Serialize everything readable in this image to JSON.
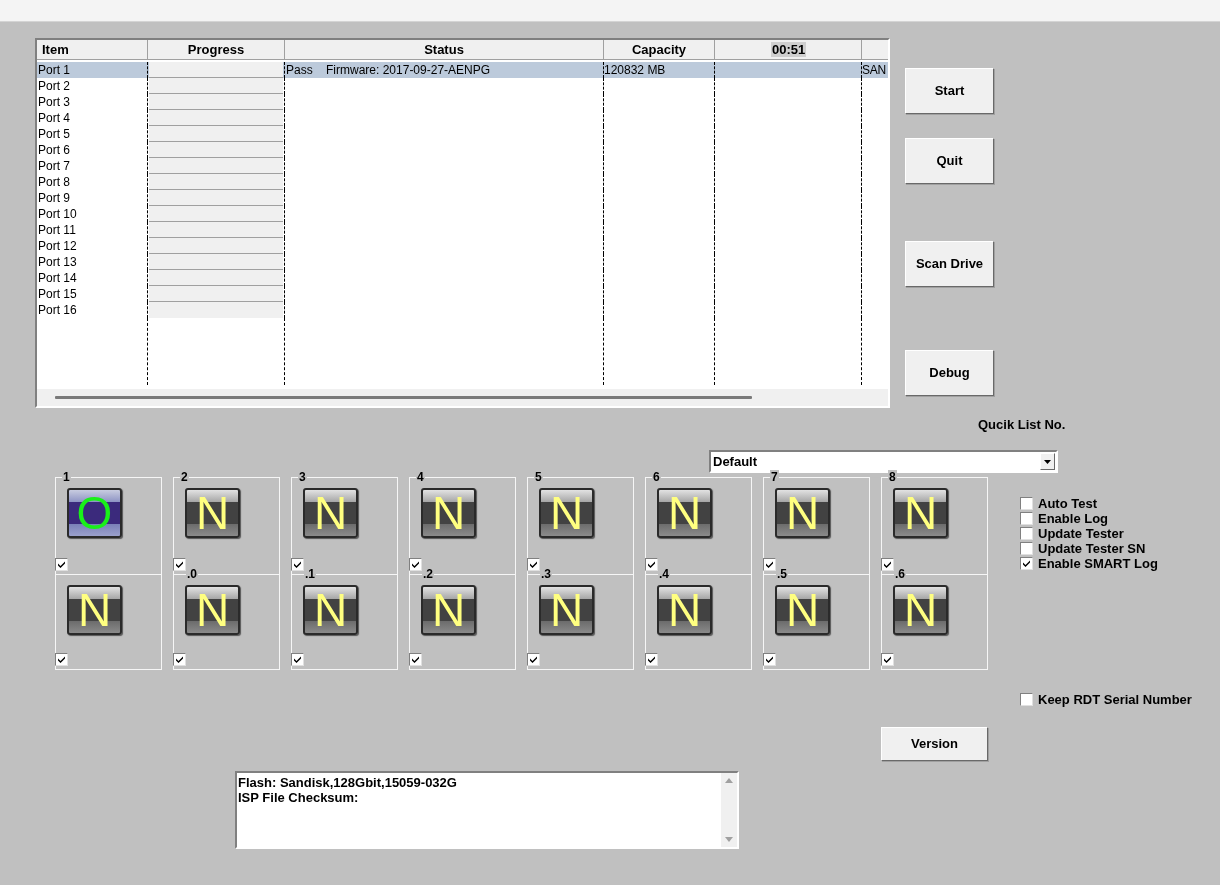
{
  "table": {
    "columns": [
      "Item",
      "Progress",
      "Status",
      "Capacity"
    ],
    "timer": "00:51",
    "rows": [
      {
        "item": "Port 1",
        "selected": true,
        "status": "Pass    Firmware: 2017-09-27-AENPG",
        "capacity": "120832 MB",
        "column_6": "SAN"
      },
      {
        "item": "Port 2",
        "selected": false
      },
      {
        "item": "Port 3",
        "selected": false
      },
      {
        "item": "Port 4",
        "selected": false
      },
      {
        "item": "Port 5",
        "selected": false
      },
      {
        "item": "Port 6",
        "selected": false
      },
      {
        "item": "Port 7",
        "selected": false
      },
      {
        "item": "Port 8",
        "selected": false
      },
      {
        "item": "Port 9",
        "selected": false
      },
      {
        "item": "Port 10",
        "selected": false
      },
      {
        "item": "Port 11",
        "selected": false
      },
      {
        "item": "Port 12",
        "selected": false
      },
      {
        "item": "Port 13",
        "selected": false
      },
      {
        "item": "Port 14",
        "selected": false
      },
      {
        "item": "Port 15",
        "selected": false
      },
      {
        "item": "Port 16",
        "selected": false
      }
    ]
  },
  "buttons": [
    "Start",
    "Quit",
    "Scan Drive",
    "Debug"
  ],
  "quick_list": {
    "label": "Qucik List No.",
    "value": "Default"
  },
  "ports": [
    {
      "label": "1",
      "kind": "pass",
      "mark": "O",
      "checked": true
    },
    {
      "label": "2",
      "kind": "idle",
      "mark": "N",
      "checked": true
    },
    {
      "label": "3",
      "kind": "idle",
      "mark": "N",
      "checked": true
    },
    {
      "label": "4",
      "kind": "idle",
      "mark": "N",
      "checked": true
    },
    {
      "label": "5",
      "kind": "idle",
      "mark": "N",
      "checked": true
    },
    {
      "label": "6",
      "kind": "idle",
      "mark": "N",
      "checked": true
    },
    {
      "label": "7",
      "kind": "idle",
      "mark": "N",
      "checked": true
    },
    {
      "label": "8",
      "kind": "idle",
      "mark": "N",
      "checked": true
    },
    {
      "kind": "idle",
      "mark": "N",
      "checked": true
    },
    {
      "label": ".0",
      "kind": "idle",
      "mark": "N",
      "checked": true
    },
    {
      "label": ".1",
      "kind": "idle",
      "mark": "N",
      "checked": true
    },
    {
      "label": ".2",
      "kind": "idle",
      "mark": "N",
      "checked": true
    },
    {
      "label": ".3",
      "kind": "idle",
      "mark": "N",
      "checked": true
    },
    {
      "label": ".4",
      "kind": "idle",
      "mark": "N",
      "checked": true
    },
    {
      "label": ".5",
      "kind": "idle",
      "mark": "N",
      "checked": true
    },
    {
      "label": ".6",
      "kind": "idle",
      "mark": "N",
      "checked": true
    }
  ],
  "options": [
    {
      "label": "Auto Test",
      "checked": false
    },
    {
      "label": "Enable Log",
      "checked": false
    },
    {
      "label": "Update Tester",
      "checked": false
    },
    {
      "label": "Update Tester SN",
      "checked": false
    },
    {
      "label": "Enable SMART Log",
      "checked": true
    }
  ],
  "keep_serial": {
    "label": "Keep RDT Serial Number",
    "checked": false
  },
  "version_button": "Version",
  "log": [
    "Flash: Sandisk,128Gbit,15059-032G",
    "ISP File Checksum:"
  ]
}
